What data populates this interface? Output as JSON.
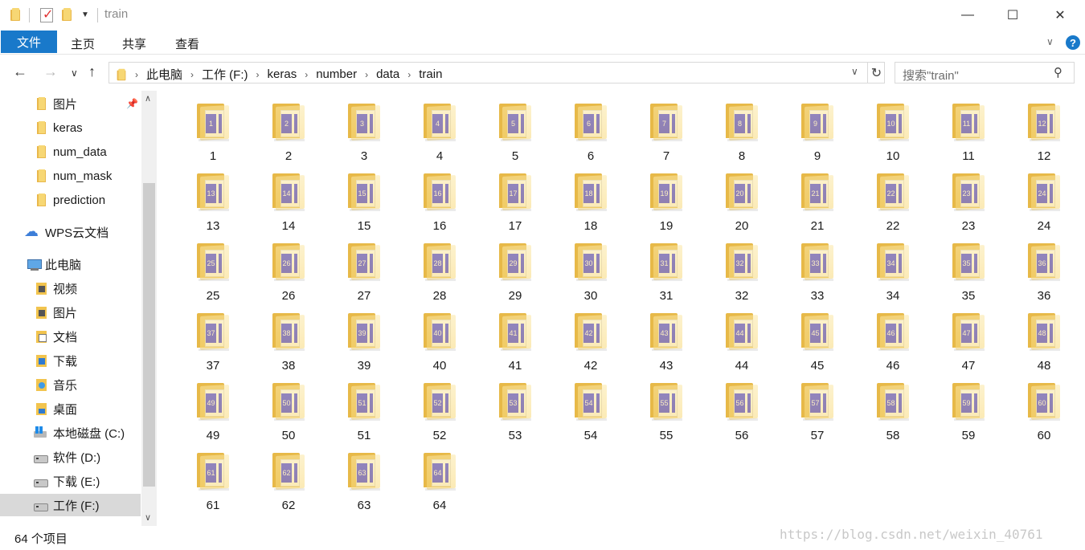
{
  "window": {
    "title": "train",
    "minimize_glyph": "—",
    "maximize_glyph": "☐",
    "close_glyph": "✕"
  },
  "ribbon": {
    "tabs": [
      "文件",
      "主页",
      "共享",
      "查看"
    ],
    "active_tab": "文件",
    "accent_color": "#1979ca",
    "expand_glyph": "∨",
    "help_glyph": "?"
  },
  "navigation": {
    "back_glyph": "←",
    "forward_glyph": "→",
    "recent_glyph": "∨",
    "up_glyph": "↑"
  },
  "address": {
    "crumbs": [
      "此电脑",
      "工作 (F:)",
      "keras",
      "number",
      "data",
      "train"
    ],
    "refresh_glyph": "↻",
    "dropdown_glyph": "∨"
  },
  "search": {
    "placeholder": "搜索\"train\"",
    "icon": "search-icon"
  },
  "sidebar": {
    "quick_access": [
      {
        "label": "图片",
        "icon": "pictures-folder-icon",
        "pinned": true
      },
      {
        "label": "keras",
        "icon": "folder-icon"
      },
      {
        "label": "num_data",
        "icon": "folder-icon"
      },
      {
        "label": "num_mask",
        "icon": "folder-icon"
      },
      {
        "label": "prediction",
        "icon": "folder-icon"
      }
    ],
    "cloud": {
      "label": "WPS云文档",
      "icon": "cloud-icon"
    },
    "this_pc": {
      "label": "此电脑",
      "icon": "computer-icon"
    },
    "pc_items": [
      {
        "label": "视频",
        "icon": "videos-icon"
      },
      {
        "label": "图片",
        "icon": "pictures-icon"
      },
      {
        "label": "文档",
        "icon": "documents-icon"
      },
      {
        "label": "下载",
        "icon": "downloads-icon"
      },
      {
        "label": "音乐",
        "icon": "music-icon"
      },
      {
        "label": "桌面",
        "icon": "desktop-icon"
      },
      {
        "label": "本地磁盘 (C:)",
        "icon": "windows-drive-icon"
      },
      {
        "label": "软件 (D:)",
        "icon": "drive-icon"
      },
      {
        "label": "下载 (E:)",
        "icon": "drive-icon"
      },
      {
        "label": "工作 (F:)",
        "icon": "drive-icon",
        "selected": true
      }
    ]
  },
  "content": {
    "folders": [
      "1",
      "2",
      "3",
      "4",
      "5",
      "6",
      "7",
      "8",
      "9",
      "10",
      "11",
      "12",
      "13",
      "14",
      "15",
      "16",
      "17",
      "18",
      "19",
      "20",
      "21",
      "22",
      "23",
      "24",
      "25",
      "26",
      "27",
      "28",
      "29",
      "30",
      "31",
      "32",
      "33",
      "34",
      "35",
      "36",
      "37",
      "38",
      "39",
      "40",
      "41",
      "42",
      "43",
      "44",
      "45",
      "46",
      "47",
      "48",
      "49",
      "50",
      "51",
      "52",
      "53",
      "54",
      "55",
      "56",
      "57",
      "58",
      "59",
      "60",
      "61",
      "62",
      "63",
      "64"
    ],
    "folder_color": "#f8d97a",
    "thumb_color": "#1010e8"
  },
  "status": {
    "item_count": "64 个项目"
  },
  "watermark": "https://blog.csdn.net/weixin_40761"
}
